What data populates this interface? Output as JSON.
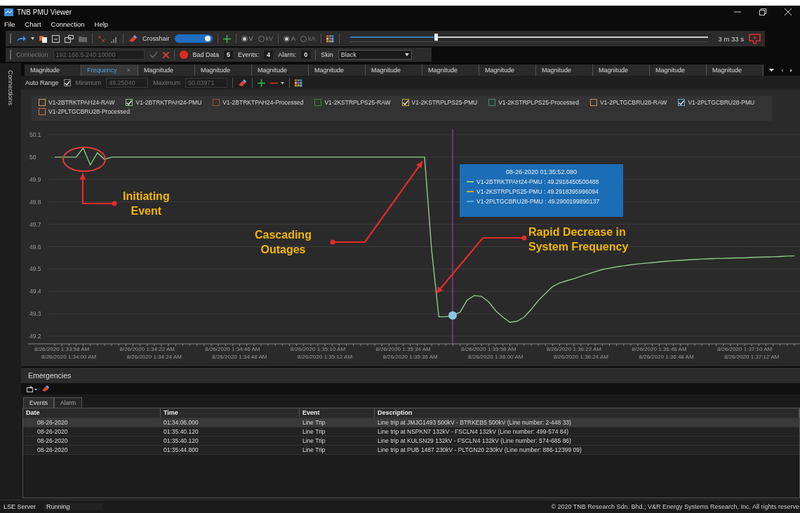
{
  "window": {
    "title": "TNB PMU Viewer"
  },
  "menu": [
    "File",
    "Chart",
    "Connection",
    "Help"
  ],
  "toolbar": {
    "crosshair": {
      "label": "Crosshair",
      "on": true
    },
    "voltage_units": [
      {
        "label": "V",
        "selected": true
      },
      {
        "label": "kV",
        "selected": false
      }
    ],
    "current_units": [
      {
        "label": "A",
        "selected": true
      },
      {
        "label": "kA",
        "selected": false
      }
    ],
    "playback": {
      "level": 0.24,
      "duration": "3 m 33 s"
    }
  },
  "connection_bar": {
    "label": "Connection",
    "address": "192.168.5.240:10000",
    "disabled": true,
    "bad_data": {
      "label": "Bad Data",
      "count": "5"
    },
    "events": {
      "label": "Events:",
      "count": "4"
    },
    "alarm": {
      "label": "Alarm:",
      "count": "0"
    },
    "skin": {
      "label": "Skin",
      "value": "Black"
    }
  },
  "side_panel": {
    "label": "Connections"
  },
  "tabs": [
    {
      "label": "Magnitude",
      "selected": false
    },
    {
      "label": "Frequency",
      "selected": true,
      "close": "×"
    },
    {
      "label": "Magnitude",
      "selected": false
    },
    {
      "label": "Magnitude",
      "selected": false
    },
    {
      "label": "Magnitude",
      "selected": false
    },
    {
      "label": "Magnitude",
      "selected": false
    },
    {
      "label": "Magnitude",
      "selected": false
    },
    {
      "label": "Magnitude",
      "selected": false
    },
    {
      "label": "Magnitude",
      "selected": false
    },
    {
      "label": "Magnitude",
      "selected": false
    },
    {
      "label": "Magnitude",
      "selected": false
    },
    {
      "label": "Magnitude",
      "selected": false
    },
    {
      "label": "Magnitude",
      "selected": false
    }
  ],
  "range_bar": {
    "auto_range": {
      "label": "Auto Range",
      "checked": true
    },
    "minimum": {
      "label": "Minimum",
      "value": "49.25040"
    },
    "maximum": {
      "label": "Maximum",
      "value": "50.03971"
    },
    "disabled": true
  },
  "legend": [
    {
      "label": "V1-2BTRKTPAH24-RAW",
      "checked": false,
      "color": "#c8a060"
    },
    {
      "label": "V1-2BTRKTPAH24-PMU",
      "checked": true,
      "color": "#8fc98a"
    },
    {
      "label": "V1-2BTRKTPAH24-Processed",
      "checked": false,
      "color": "#a04a30"
    },
    {
      "label": "V1-2KSTRPLPS25-RAW",
      "checked": false,
      "color": "#3a8a3a"
    },
    {
      "label": "V1-2KSTRPLPS25-PMU",
      "checked": true,
      "color": "#c8b020"
    },
    {
      "label": "V1-2KSTRPLPS25-Processed",
      "checked": false,
      "color": "#3a8a7a"
    },
    {
      "label": "V1-2PLTGCBRU28-RAW",
      "checked": false,
      "color": "#c89060"
    },
    {
      "label": "V1-2PLTGCBRU28-PMU",
      "checked": true,
      "color": "#60a8d8"
    },
    {
      "label": "V1-2PLTGCBRU28-Processed",
      "checked": false,
      "color": "#c87850"
    }
  ],
  "chart": {
    "chart_data": {
      "type": "line",
      "grid": true,
      "ylim": [
        49.17,
        50.13
      ],
      "yticks": [
        50.1,
        50,
        49.9,
        49.8,
        49.7,
        49.6,
        49.5,
        49.4,
        49.3,
        49.2
      ],
      "categories": [
        null,
        "8/26/2020 1:33:58 AM",
        null,
        null,
        null,
        null,
        null,
        null,
        null,
        null,
        null,
        null,
        null,
        "8/26/2020 1:34:22 AM",
        null,
        null,
        null,
        null,
        null,
        null,
        null,
        null,
        null,
        null,
        null,
        "8/26/2020 1:34:46 AM",
        null,
        null,
        null,
        null,
        null,
        null,
        null,
        null,
        null,
        null,
        null,
        "8/26/2020 1:35:10 AM",
        null,
        null,
        null,
        null,
        null,
        null,
        null,
        null,
        null,
        null,
        null,
        "8/26/2020 1:35:34 AM",
        null,
        null,
        null,
        null,
        null,
        null,
        null,
        null,
        null,
        null,
        null,
        "8/26/2020 1:35:58 AM",
        null,
        null,
        null,
        null,
        null,
        null,
        null,
        null,
        null,
        null,
        null,
        "8/26/2020 1:36:22 AM",
        null,
        null,
        null,
        null,
        null,
        null,
        null,
        null,
        null,
        null,
        null,
        "8/26/2020 1:36:46 AM",
        null,
        null,
        null,
        null,
        null,
        null,
        null,
        null,
        null,
        null,
        null,
        "8/26/2020 1:37:10 AM",
        null,
        null,
        null,
        null,
        null,
        null,
        null
      ],
      "series": [
        {
          "color": "#8fc98a",
          "values": [
            50,
            50,
            50,
            50,
            50.04,
            49.965,
            50.02,
            49.99,
            50,
            50,
            50,
            50,
            50,
            50,
            50,
            50,
            50,
            50,
            50,
            50,
            50,
            50,
            50,
            50,
            50,
            50,
            50,
            50,
            50,
            50,
            50,
            50,
            50,
            50,
            50,
            50,
            50,
            50,
            50,
            50,
            50,
            50,
            50,
            50,
            50,
            50,
            50,
            50,
            50,
            50,
            50,
            50,
            50,
            49.585,
            49.287,
            49.287,
            49.293,
            49.308,
            49.362,
            49.382,
            49.378,
            49.354,
            49.314,
            49.286,
            49.262,
            49.267,
            49.285,
            49.32,
            49.36,
            49.392,
            49.422,
            49.438,
            49.448,
            49.457,
            49.468,
            49.478,
            49.488,
            49.498,
            49.504,
            49.51,
            49.514,
            49.519,
            49.523,
            49.526,
            49.529,
            49.532,
            49.535,
            49.537,
            49.539,
            49.541,
            49.543,
            49.545,
            49.546,
            49.547,
            49.548,
            49.549,
            49.55,
            49.55,
            49.552,
            49.553,
            49.554,
            49.555,
            49.556,
            49.558,
            49.559
          ]
        }
      ]
    },
    "secondary_axis_labels": [
      "8/26/2020 1:34:00 AM",
      "8/26/2020 1:34:24 AM",
      "8/26/2020 1:34:48 AM",
      "8/26/2020 1:35:12 AM",
      "8/26/2020 1:35:36 AM",
      "8/26/2020 1:36:00 AM",
      "8/26/2020 1:36:24 AM",
      "8/26/2020 1:36:48 AM",
      "8/26/2020 1:37:12 AM"
    ],
    "tooltip": {
      "title": "08-26-2020 01:35:52.080",
      "rows": [
        {
          "text": "V1-2BTRKTPAH24-PMU : 49.2916450500488",
          "color": "#8fc98a"
        },
        {
          "text": "V1-2KSTRPLPS25-PMU : 49.2918395996094",
          "color": "#c8b020"
        },
        {
          "text": "V1-2PLTGCBRU28-PMU : 49.2900199890137",
          "color": "#60a8d8"
        }
      ]
    },
    "annotations": [
      {
        "lines": [
          "Initiating",
          "Event"
        ]
      },
      {
        "lines": [
          "Cascading",
          "Outages"
        ]
      },
      {
        "lines": [
          "Rapid Decrease in",
          "System Frequency"
        ]
      }
    ]
  },
  "emergencies": {
    "title": "Emergencies",
    "tabs": [
      {
        "label": "Events",
        "selected": true
      },
      {
        "label": "Alarm",
        "selected": false
      }
    ],
    "columns": [
      "Date",
      "Time",
      "Event",
      "Description"
    ],
    "rows": [
      {
        "cells": [
          "08-26-2020",
          "01:34:06.000",
          "Line Trip",
          "Line trip at JMJG1493 500kV - BTRKEB5 500kV (Line number: 2-448 33)"
        ],
        "selected": true
      },
      {
        "cells": [
          "08-26-2020",
          "01:35:40.120",
          "Line Trip",
          "Line trip at NSPKN7 132kV - FSCLN4 132kV (Line number: 499-574 84)"
        ],
        "selected": false
      },
      {
        "cells": [
          "08-26-2020",
          "01:35:40.120",
          "Line Trip",
          "Line trip at KULSN29 132kV - FSCLN4 132kV (Line number: 574-685 86)"
        ],
        "selected": false
      },
      {
        "cells": [
          "08-26-2020",
          "01:35:44.800",
          "Line Trip",
          "Line trip at PUB 1487 230kV - PLTGN20 230kV (Line number: 886-12399 09)"
        ],
        "selected": false
      }
    ]
  },
  "status_bar": {
    "server": "LSE Server",
    "state": "Running",
    "copyright": "© 2020 TNB Research Sdn. Bhd.; V&R Energy Systems Research, Inc. All rights reserve"
  }
}
